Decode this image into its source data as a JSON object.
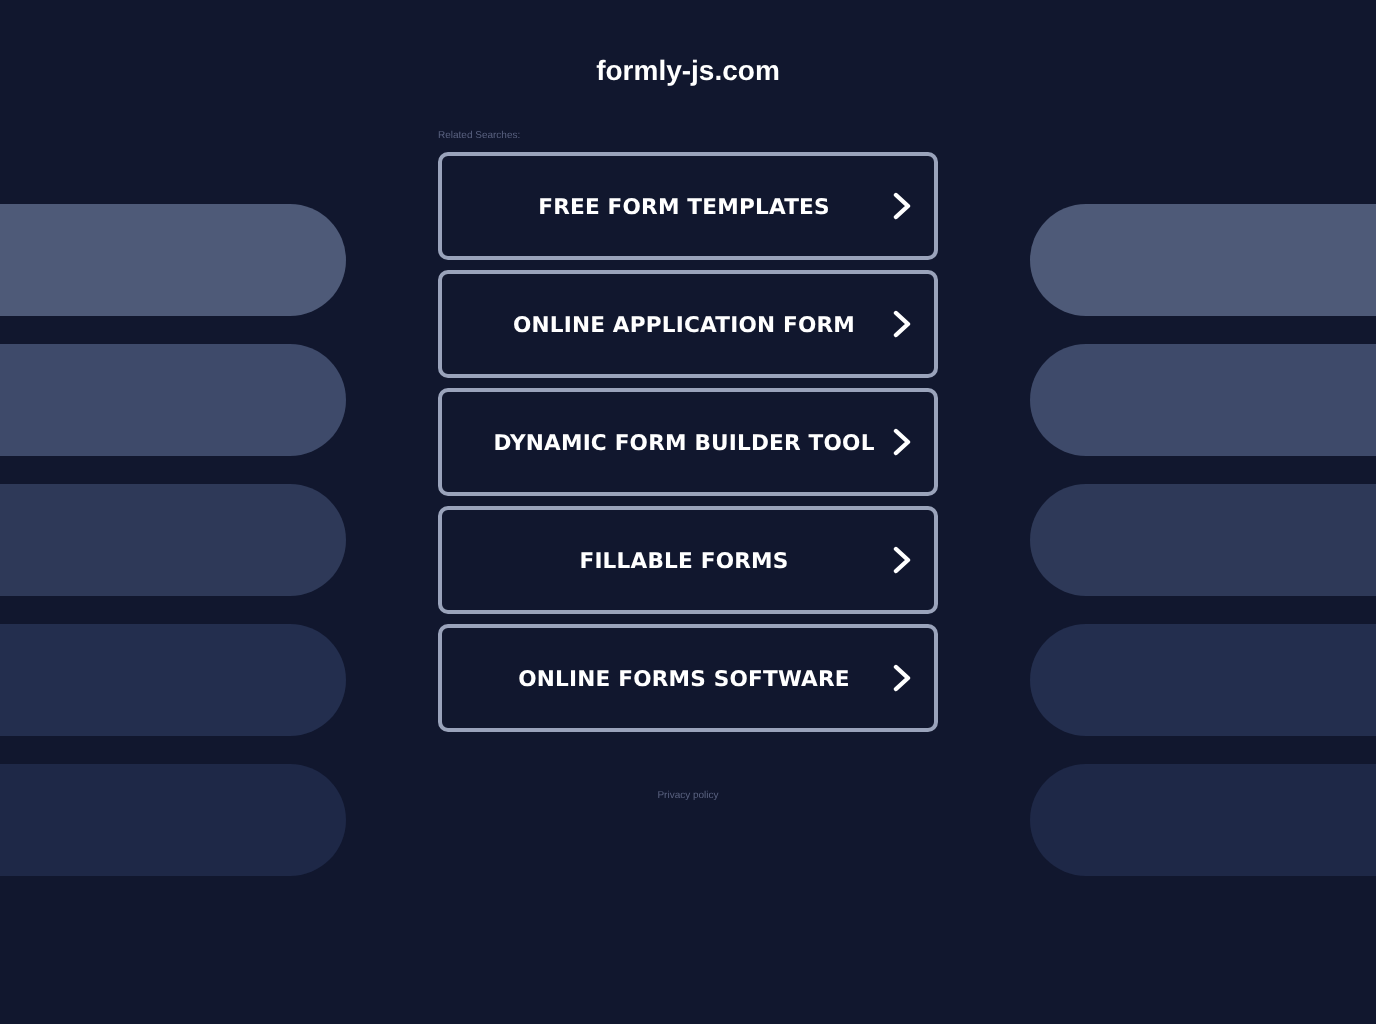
{
  "site_title": "formly-js.com",
  "related_label": "Related Searches:",
  "links": [
    {
      "label": "FREE FORM TEMPLATES"
    },
    {
      "label": "ONLINE APPLICATION FORM"
    },
    {
      "label": "DYNAMIC FORM BUILDER TOOL"
    },
    {
      "label": "FILLABLE FORMS"
    },
    {
      "label": "ONLINE FORMS SOFTWARE"
    }
  ],
  "footer_link": "Privacy policy"
}
